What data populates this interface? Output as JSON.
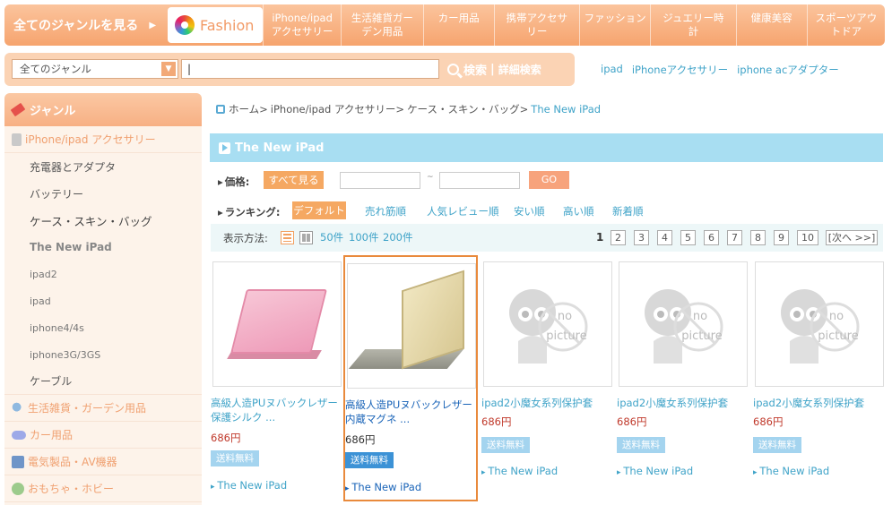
{
  "topnav": {
    "all_genres": "全てのジャンルを見る",
    "fashion": "Fashion",
    "categories": [
      "iPhone/ipad アクセサリー",
      "生活雑貨ガーデン用品",
      "カー用品",
      "携帯アクセサリー",
      "ファッション",
      "ジュエリー時計",
      "健康美容",
      "スポーツアウトドア"
    ]
  },
  "search": {
    "genre_select": "全てのジャンル",
    "value": "|",
    "button": "検索",
    "separator": "|",
    "detail": "詳細検索",
    "keywords": [
      "ipad",
      "iPhoneアクセサリー",
      "iphone acアダプター"
    ]
  },
  "sidebar": {
    "title": "ジャンル",
    "top_category": "iPhone/ipad アクセサリー",
    "subitems": [
      "充電器とアダプタ",
      "バッテリー",
      "ケース・スキン・バッグ",
      "The New iPad",
      "ipad2",
      "ipad",
      "iphone4/4s",
      "iphone3G/3GS",
      "ケーブル"
    ],
    "categories": [
      "生活雑貨・ガーデン用品",
      "カー用品",
      "電気製品・AV機器",
      "おもちゃ・ホビー"
    ]
  },
  "breadcrumb": {
    "home": "ホーム",
    "level1": "iPhone/ipad アクセサリー",
    "level2": "ケース・スキン・バッグ",
    "current": "The New iPad",
    "sep": ">"
  },
  "page_title": "The New iPad",
  "filters": {
    "price_label": "価格:",
    "price_all": "すべて見る",
    "tilde": "~",
    "go": "GO",
    "ranking_label": "ランキング:",
    "ranking_options": [
      "デフォルト",
      "売れ筋順",
      "人気レビュー順",
      "安い順",
      "高い順",
      "新着順"
    ]
  },
  "view": {
    "label": "表示方法:",
    "per_page": [
      "50件",
      "100件",
      "200件"
    ],
    "current_page": "1",
    "pages": [
      "2",
      "3",
      "4",
      "5",
      "6",
      "7",
      "8",
      "9",
      "10"
    ],
    "next": "[次へ >>]"
  },
  "products": [
    {
      "name": "高級人造PUヌバックレザー保護シルク ...",
      "price": "686円",
      "shipping": "送料無料",
      "tag": "The New iPad",
      "image": "pink-tablet-case"
    },
    {
      "name": "高級人造PUヌバックレザー内蔵マグネ ...",
      "price": "686円",
      "shipping": "送料無料",
      "tag": "The New iPad",
      "image": "beige-tablet-case"
    },
    {
      "name": "ipad2小魔女系列保护套",
      "price": "686円",
      "shipping": "送料無料",
      "tag": "The New iPad",
      "image": "no-picture"
    },
    {
      "name": "ipad2小魔女系列保护套",
      "price": "686円",
      "shipping": "送料無料",
      "tag": "The New iPad",
      "image": "no-picture"
    },
    {
      "name": "ipad2小魔女系列保护套",
      "price": "686円",
      "shipping": "送料無料",
      "tag": "The New iPad",
      "image": "no-picture"
    }
  ],
  "no_picture": {
    "line1": "no",
    "line2": "picture"
  }
}
